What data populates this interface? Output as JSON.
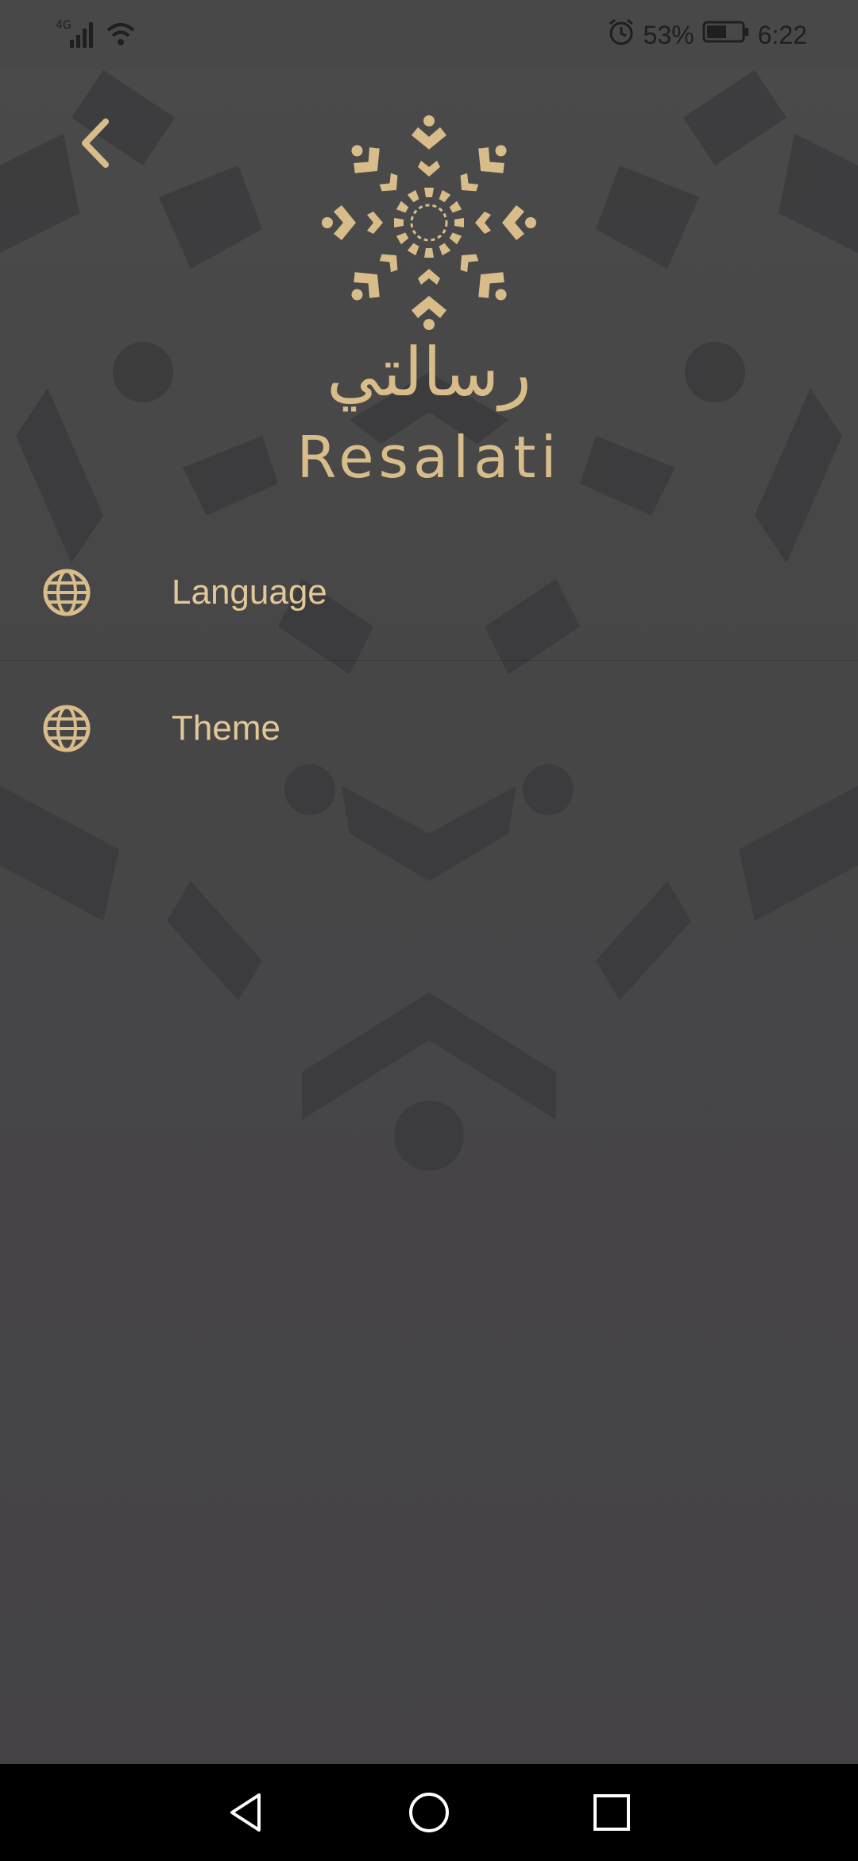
{
  "status_bar": {
    "network_label": "4G",
    "battery_percent": "53%",
    "time": "6:22",
    "icons": [
      "cellular-signal-icon",
      "wifi-icon",
      "alarm-icon",
      "battery-icon"
    ]
  },
  "header": {
    "back_icon": "chevron-left-icon",
    "logo_arabic": "رسالتي",
    "logo_latin": "Resalati"
  },
  "menu": {
    "items": [
      {
        "label": "Language",
        "icon": "globe-icon"
      },
      {
        "label": "Theme",
        "icon": "globe-icon"
      }
    ]
  },
  "nav_bar": {
    "buttons": [
      "back-triangle-icon",
      "home-circle-icon",
      "recents-square-icon"
    ]
  },
  "colors": {
    "background": "#444345",
    "accent_gold": "#d8bd8a",
    "status_text": "#1f1f1f",
    "nav_bar": "#000000"
  }
}
